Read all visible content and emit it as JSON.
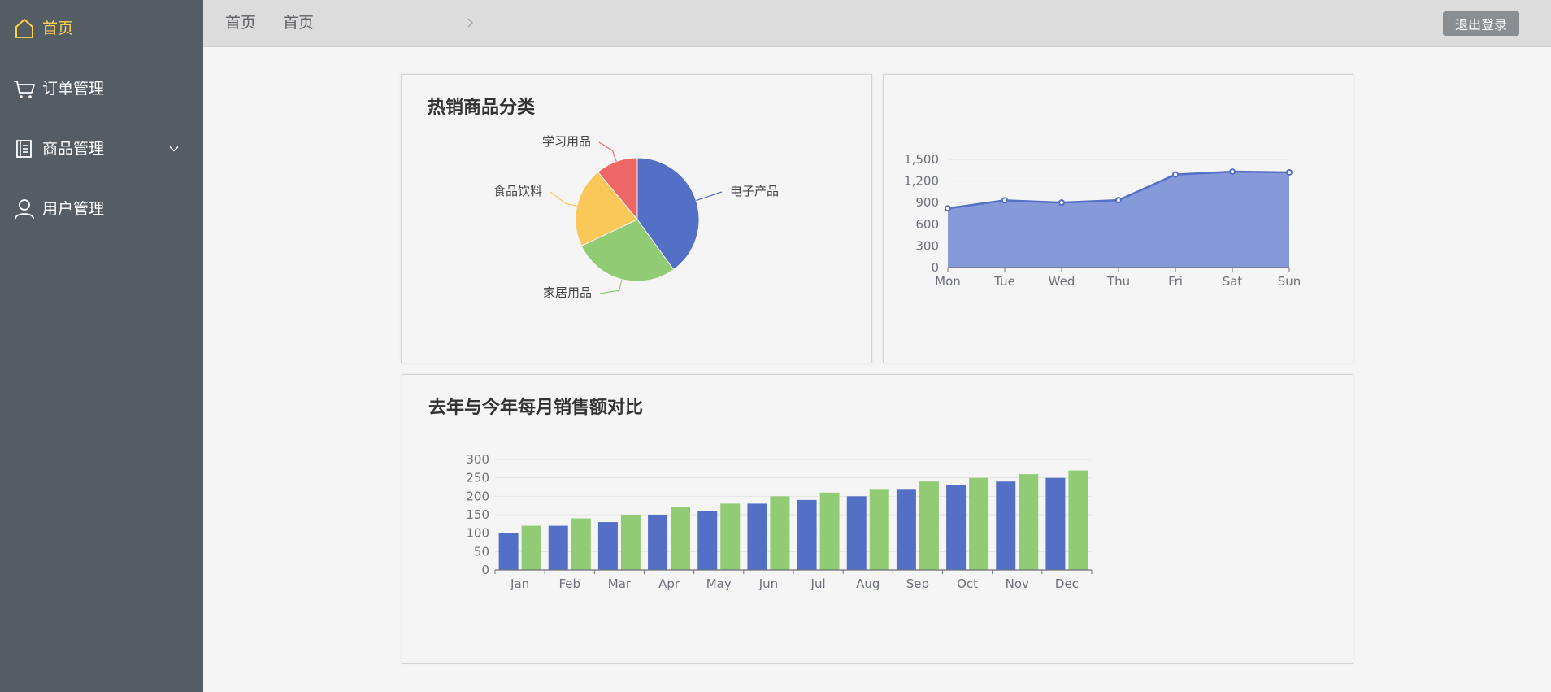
{
  "sidebar": {
    "items": [
      {
        "label": "首页",
        "icon": "home-icon"
      },
      {
        "label": "订单管理",
        "icon": "cart-icon"
      },
      {
        "label": "商品管理",
        "icon": "document-icon"
      },
      {
        "label": "用户管理",
        "icon": "user-icon"
      }
    ],
    "active_color": "#ffd04b",
    "background": "#545c64"
  },
  "header": {
    "breadcrumb": [
      "首页",
      "首页"
    ],
    "logout_label": "退出登录"
  },
  "pie_card": {
    "title": "热销商品分类"
  },
  "bar_card": {
    "title": "去年与今年每月销售额对比"
  },
  "colors": {
    "blue": "#5470c6",
    "green": "#91cc75",
    "yellow": "#fac858",
    "red": "#ee6666",
    "area_fill": "#7f93d6"
  },
  "chart_data": [
    {
      "type": "pie",
      "title": "热销商品分类",
      "categories": [
        "电子产品",
        "家居用品",
        "食品饮料",
        "学习用品"
      ],
      "values": [
        40,
        28,
        21,
        11
      ],
      "colors": [
        "#5470c6",
        "#91cc75",
        "#fac858",
        "#ee6666"
      ]
    },
    {
      "type": "area",
      "categories": [
        "Mon",
        "Tue",
        "Wed",
        "Thu",
        "Fri",
        "Sat",
        "Sun"
      ],
      "values": [
        820,
        932,
        901,
        934,
        1290,
        1330,
        1320
      ],
      "ylim": [
        0,
        1500
      ],
      "yticks": [
        "0",
        "300",
        "600",
        "900",
        "1,200",
        "1,500"
      ],
      "ytick_values": [
        0,
        300,
        600,
        900,
        1200,
        1500
      ]
    },
    {
      "type": "bar",
      "title": "去年与今年每月销售额对比",
      "categories": [
        "Jan",
        "Feb",
        "Mar",
        "Apr",
        "May",
        "Jun",
        "Jul",
        "Aug",
        "Sep",
        "Oct",
        "Nov",
        "Dec"
      ],
      "series": [
        {
          "values": [
            100,
            120,
            130,
            150,
            160,
            180,
            190,
            200,
            220,
            230,
            240,
            250
          ]
        },
        {
          "values": [
            120,
            140,
            150,
            170,
            180,
            200,
            210,
            220,
            240,
            250,
            260,
            270
          ]
        }
      ],
      "ylim": [
        0,
        300
      ],
      "yticks": [
        "0",
        "50",
        "100",
        "150",
        "200",
        "250",
        "300"
      ],
      "ytick_values": [
        0,
        50,
        100,
        150,
        200,
        250,
        300
      ]
    }
  ]
}
